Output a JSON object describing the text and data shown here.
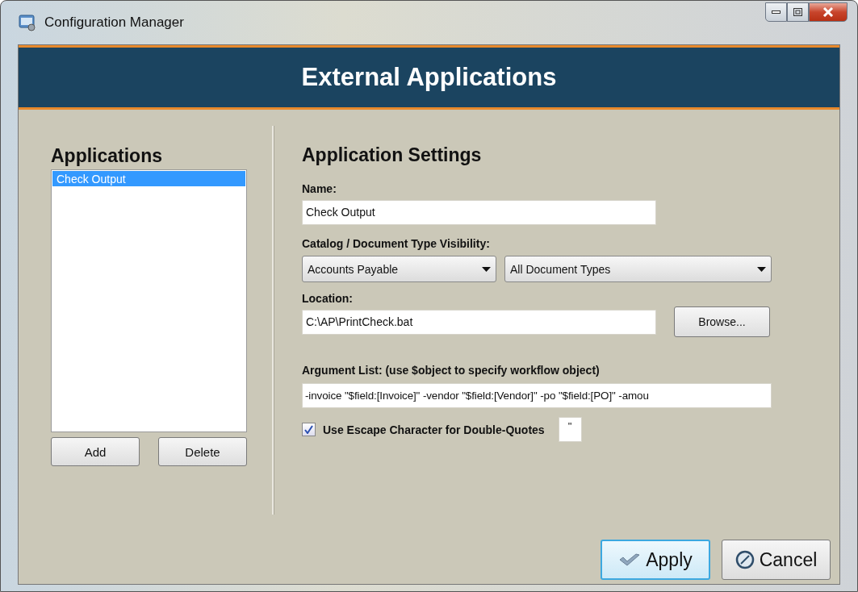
{
  "window": {
    "title": "Configuration Manager"
  },
  "header": {
    "title": "External Applications"
  },
  "applications": {
    "title": "Applications",
    "items": [
      {
        "label": "Check Output",
        "selected": true
      }
    ],
    "buttons": [
      "Add",
      "Delete"
    ]
  },
  "settings": {
    "title": "Application Settings",
    "name": {
      "label": "Name:",
      "value": "Check Output"
    },
    "visibility": {
      "label": "Catalog / Document Type Visibility:",
      "catalog": "Accounts Payable",
      "document_type": "All Document Types"
    },
    "location": {
      "label": "Location:",
      "value": "C:\\AP\\PrintCheck.bat",
      "button": "Browse..."
    },
    "arguments": {
      "label": "Argument List: (use $object to specify workflow object)",
      "value": "-invoice \"$field:[Invoice]\" -vendor \"$field:[Vendor]\" -po \"$field:[PO]\" -amou"
    },
    "escape": {
      "label": "Use Escape Character for Double-Quotes",
      "checked": true,
      "value": "\""
    }
  },
  "footer": {
    "buttons": [
      {
        "label": "Apply",
        "kind": "apply"
      },
      {
        "label": "Cancel",
        "kind": "cancel"
      }
    ]
  }
}
